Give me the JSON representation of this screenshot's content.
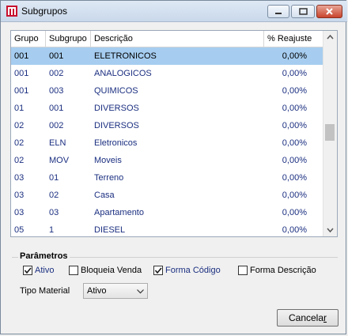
{
  "window": {
    "title": "Subgrupos"
  },
  "grid": {
    "columns": [
      "Grupo",
      "Subgrupo",
      "Descrição",
      "% Reajuste"
    ],
    "rows": [
      {
        "grupo": "001",
        "subgrupo": "001",
        "descricao": "ELETRONICOS",
        "reajuste": "0,00%",
        "selected": true
      },
      {
        "grupo": "001",
        "subgrupo": "002",
        "descricao": "ANALOGICOS",
        "reajuste": "0,00%"
      },
      {
        "grupo": "001",
        "subgrupo": "003",
        "descricao": "QUIMICOS",
        "reajuste": "0,00%"
      },
      {
        "grupo": "01",
        "subgrupo": "001",
        "descricao": "DIVERSOS",
        "reajuste": "0,00%"
      },
      {
        "grupo": "02",
        "subgrupo": "002",
        "descricao": "DIVERSOS",
        "reajuste": "0,00%"
      },
      {
        "grupo": "02",
        "subgrupo": "ELN",
        "descricao": "Eletronicos",
        "reajuste": "0,00%"
      },
      {
        "grupo": "02",
        "subgrupo": "MOV",
        "descricao": "Moveis",
        "reajuste": "0,00%"
      },
      {
        "grupo": "03",
        "subgrupo": "01",
        "descricao": "Terreno",
        "reajuste": "0,00%"
      },
      {
        "grupo": "03",
        "subgrupo": "02",
        "descricao": "Casa",
        "reajuste": "0,00%"
      },
      {
        "grupo": "03",
        "subgrupo": "03",
        "descricao": "Apartamento",
        "reajuste": "0,00%"
      },
      {
        "grupo": "05",
        "subgrupo": "1",
        "descricao": "DIESEL",
        "reajuste": "0,00%"
      }
    ]
  },
  "params": {
    "legend": "Parâmetros",
    "checkboxes": [
      {
        "label": "Ativo",
        "checked": true,
        "highlight": true
      },
      {
        "label": "Bloqueia Venda",
        "checked": false,
        "highlight": false
      },
      {
        "label": "Forma Código",
        "checked": true,
        "highlight": true
      },
      {
        "label": "Forma Descrição",
        "checked": false,
        "highlight": false
      }
    ],
    "tipo_material_label": "Tipo Material",
    "tipo_material_value": "Ativo"
  },
  "buttons": {
    "cancel_prefix": "Cancela",
    "cancel_underlined": "r"
  },
  "colors": {
    "selection": "#a6cdf0",
    "row_text": "#1b2f80",
    "label_highlight": "#1b2f80"
  }
}
